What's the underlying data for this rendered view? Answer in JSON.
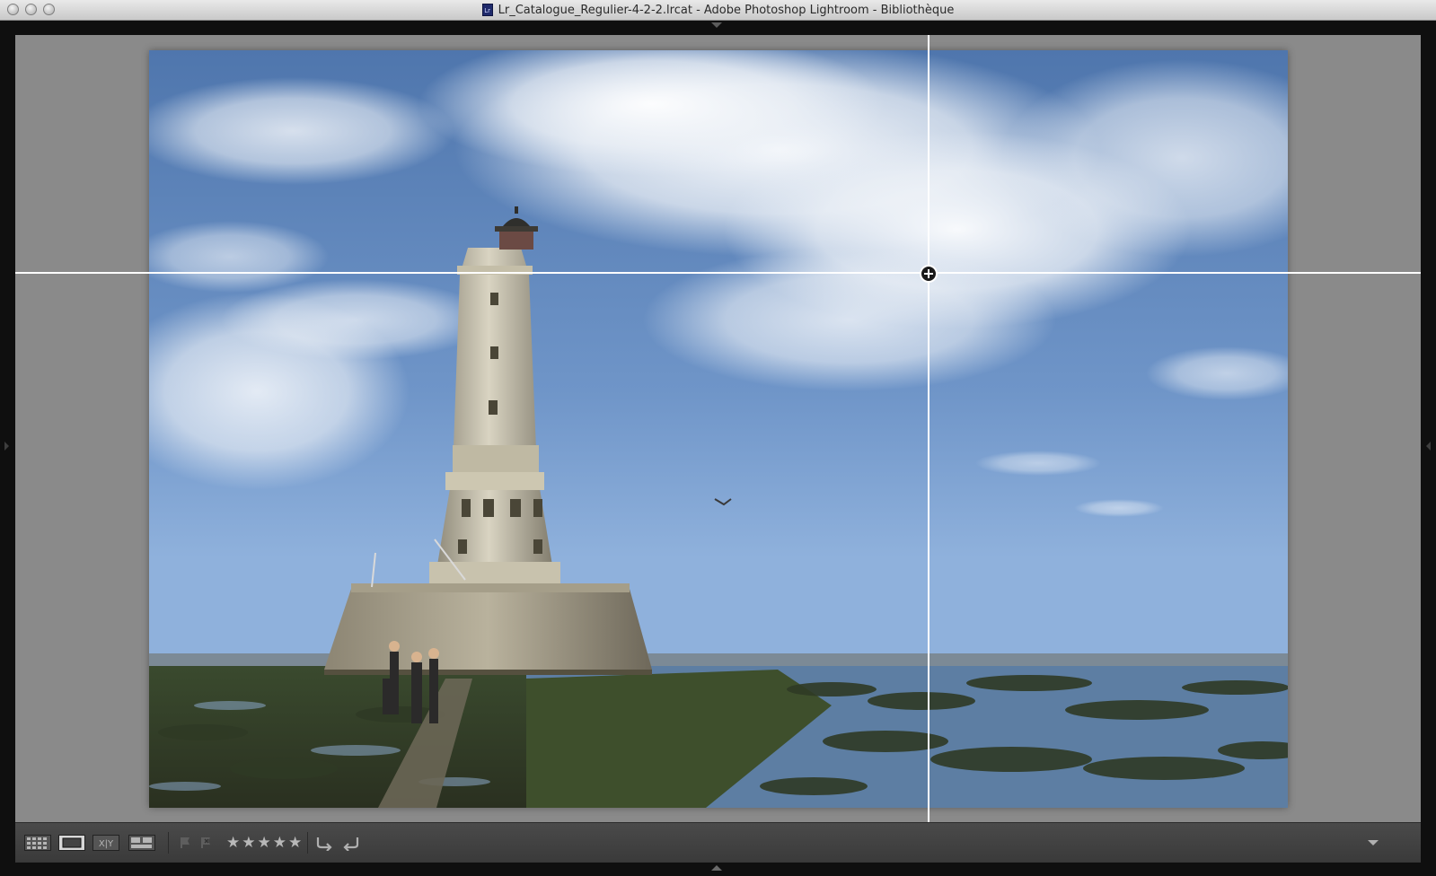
{
  "window": {
    "title": "Lr_Catalogue_Regulier-4-2-2.lrcat - Adobe Photoshop Lightroom - Bibliothèque",
    "doc_icon": "Lr",
    "controls": [
      "close",
      "minimize",
      "zoom"
    ]
  },
  "viewer": {
    "mode": "loupe",
    "guides": {
      "horizontal": true,
      "vertical": true
    },
    "photo": {
      "subject": "lighthouse"
    }
  },
  "toolbar": {
    "view_modes": [
      {
        "name": "grid-view",
        "label": ""
      },
      {
        "name": "loupe-view",
        "label": ""
      },
      {
        "name": "compare-view",
        "label": "X|Y"
      },
      {
        "name": "survey-view",
        "label": ""
      }
    ],
    "flags": [
      "pick-flag",
      "reject-flag"
    ],
    "stars": [
      "★",
      "★",
      "★",
      "★",
      "★"
    ],
    "rotate": [
      "rotate-left",
      "rotate-right"
    ]
  },
  "colors": {
    "viewer_bg": "#8a8a8a",
    "toolbar_bg": "#404040",
    "guide": "#ffffff"
  }
}
